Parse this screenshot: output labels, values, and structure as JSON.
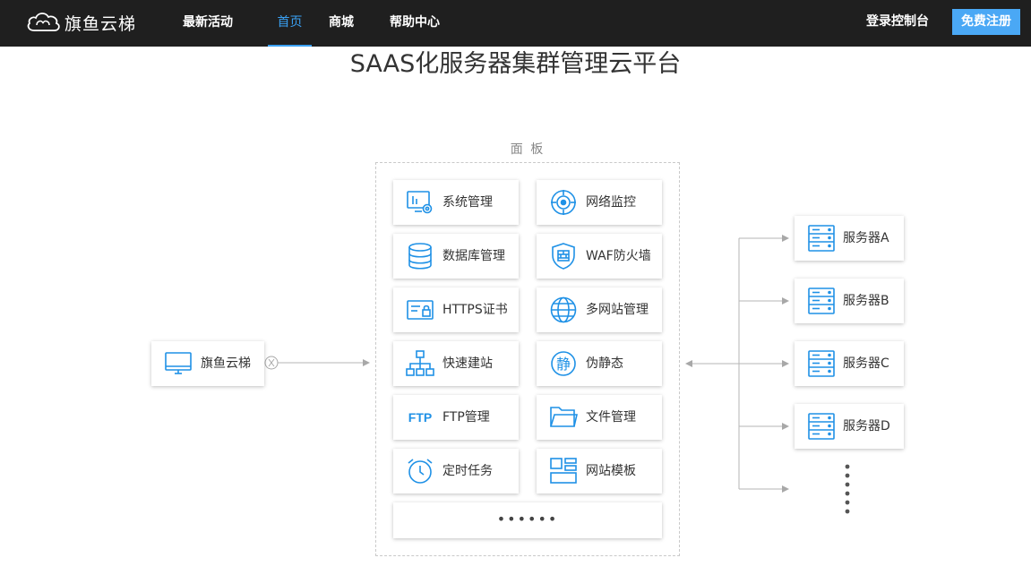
{
  "nav": {
    "brand": "旗鱼云梯",
    "links": [
      "最新活动",
      "首页",
      "商城",
      "帮助中心"
    ],
    "login": "登录控制台",
    "register": "免费注册"
  },
  "hero": {
    "title": "SAAS化服务器集群管理云平台"
  },
  "panel": {
    "label": "面 板",
    "features": [
      {
        "label": "系统管理",
        "icon": "system-settings-icon"
      },
      {
        "label": "网络监控",
        "icon": "radar-icon"
      },
      {
        "label": "数据库管理",
        "icon": "database-icon"
      },
      {
        "label": "WAF防火墙",
        "icon": "firewall-shield-icon"
      },
      {
        "label": "HTTPS证书",
        "icon": "certificate-icon"
      },
      {
        "label": "多网站管理",
        "icon": "globe-icon"
      },
      {
        "label": "快速建站",
        "icon": "sitemap-icon"
      },
      {
        "label": "伪静态",
        "icon": "static-char-icon"
      },
      {
        "label": "FTP管理",
        "icon": "ftp-icon"
      },
      {
        "label": "文件管理",
        "icon": "folder-icon"
      },
      {
        "label": "定时任务",
        "icon": "alarm-clock-icon"
      },
      {
        "label": "网站模板",
        "icon": "template-icon"
      }
    ],
    "more": "••••••"
  },
  "client": {
    "label": "旗鱼云梯",
    "icon": "monitor-icon"
  },
  "servers": [
    {
      "label": "服务器A",
      "icon": "server-icon"
    },
    {
      "label": "服务器B",
      "icon": "server-icon"
    },
    {
      "label": "服务器C",
      "icon": "server-icon"
    },
    {
      "label": "服务器D",
      "icon": "server-icon"
    }
  ],
  "colors": {
    "accent": "#1f91e6",
    "nav_bg": "#1f1f1f",
    "active_link": "#3aa0f3",
    "register_bg": "#4aa8f5"
  }
}
